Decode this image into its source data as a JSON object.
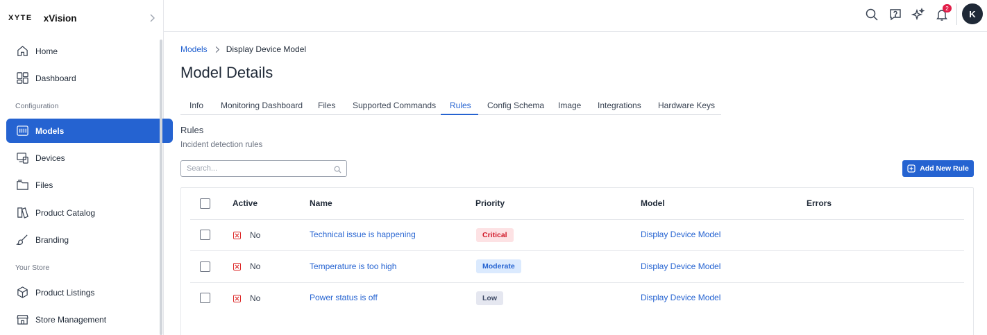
{
  "brand": {
    "logo": "XYTE",
    "app_name": "xVision"
  },
  "sidebar": {
    "items": [
      {
        "label": "Home",
        "icon": "home-icon"
      },
      {
        "label": "Dashboard",
        "icon": "dashboard-icon"
      },
      {
        "label": "Models",
        "icon": "models-icon",
        "active": true
      },
      {
        "label": "Devices",
        "icon": "devices-icon"
      },
      {
        "label": "Files",
        "icon": "files-icon"
      },
      {
        "label": "Product Catalog",
        "icon": "catalog-icon"
      },
      {
        "label": "Branding",
        "icon": "brush-icon"
      },
      {
        "label": "Product Listings",
        "icon": "box-icon"
      },
      {
        "label": "Store Management",
        "icon": "store-icon"
      }
    ],
    "sections": [
      "Configuration",
      "Your Store"
    ]
  },
  "header": {
    "notification_count": "2",
    "avatar_initial": "K"
  },
  "breadcrumb": {
    "parent": "Models",
    "current": "Display Device Model"
  },
  "page": {
    "title": "Model Details"
  },
  "tabs": [
    {
      "label": "Info"
    },
    {
      "label": "Monitoring Dashboard"
    },
    {
      "label": "Files"
    },
    {
      "label": "Supported Commands"
    },
    {
      "label": "Rules",
      "active": true
    },
    {
      "label": "Config Schema"
    },
    {
      "label": "Image"
    },
    {
      "label": "Integrations"
    },
    {
      "label": "Hardware Keys"
    }
  ],
  "rules": {
    "title": "Rules",
    "subtitle": "Incident detection rules",
    "search_placeholder": "Search...",
    "add_button": "Add New Rule"
  },
  "table": {
    "headers": {
      "active": "Active",
      "name": "Name",
      "priority": "Priority",
      "model": "Model",
      "errors": "Errors"
    },
    "rows": [
      {
        "active": "No",
        "name": "Technical issue is happening",
        "priority": "Critical",
        "model": "Display Device Model"
      },
      {
        "active": "No",
        "name": "Temperature is too high",
        "priority": "Moderate",
        "model": "Display Device Model"
      },
      {
        "active": "No",
        "name": "Power status is off",
        "priority": "Low",
        "model": "Display Device Model"
      }
    ]
  },
  "colors": {
    "accent": "#2563d1",
    "critical": "#d11a2a",
    "badge_alert": "#e11d48"
  }
}
